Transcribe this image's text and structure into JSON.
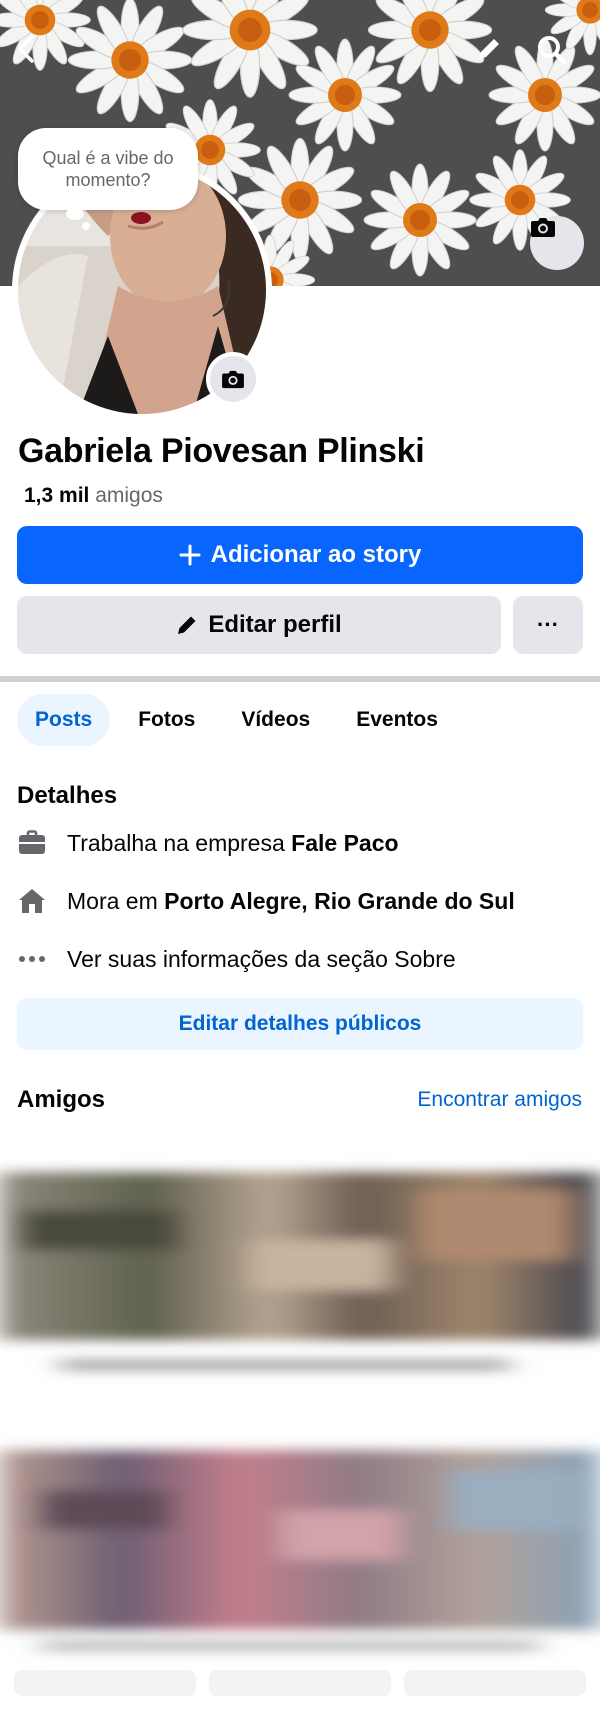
{
  "profile": {
    "name": "Gabriela Piovesan Plinski",
    "friends_count": "1,3 mil",
    "friends_label": "amigos",
    "vibe_prompt": "Qual é a vibe do momento?"
  },
  "actions": {
    "add_story": "Adicionar ao story",
    "edit_profile": "Editar perfil",
    "more": "···"
  },
  "tabs": [
    {
      "label": "Posts",
      "active": true
    },
    {
      "label": "Fotos",
      "active": false
    },
    {
      "label": "Vídeos",
      "active": false
    },
    {
      "label": "Eventos",
      "active": false
    }
  ],
  "details": {
    "title": "Detalhes",
    "work_prefix": "Trabalha na empresa ",
    "work_company": "Fale Paco",
    "home_prefix": "Mora em ",
    "home_city": "Porto Alegre, Rio Grande do Sul",
    "about_link": "Ver suas informações da seção Sobre",
    "edit_public": "Editar detalhes públicos"
  },
  "friends_section": {
    "title": "Amigos",
    "find_link": "Encontrar amigos"
  },
  "icons": [
    "back-icon",
    "pencil-icon",
    "search-icon",
    "camera-icon",
    "plus-icon",
    "briefcase-icon",
    "home-icon",
    "ellipsis-icon"
  ],
  "colors": {
    "primary": "#0866ff",
    "link": "#0064d1",
    "secondary_bg": "#e4e6eb",
    "tint_bg": "#ebf5ff"
  }
}
